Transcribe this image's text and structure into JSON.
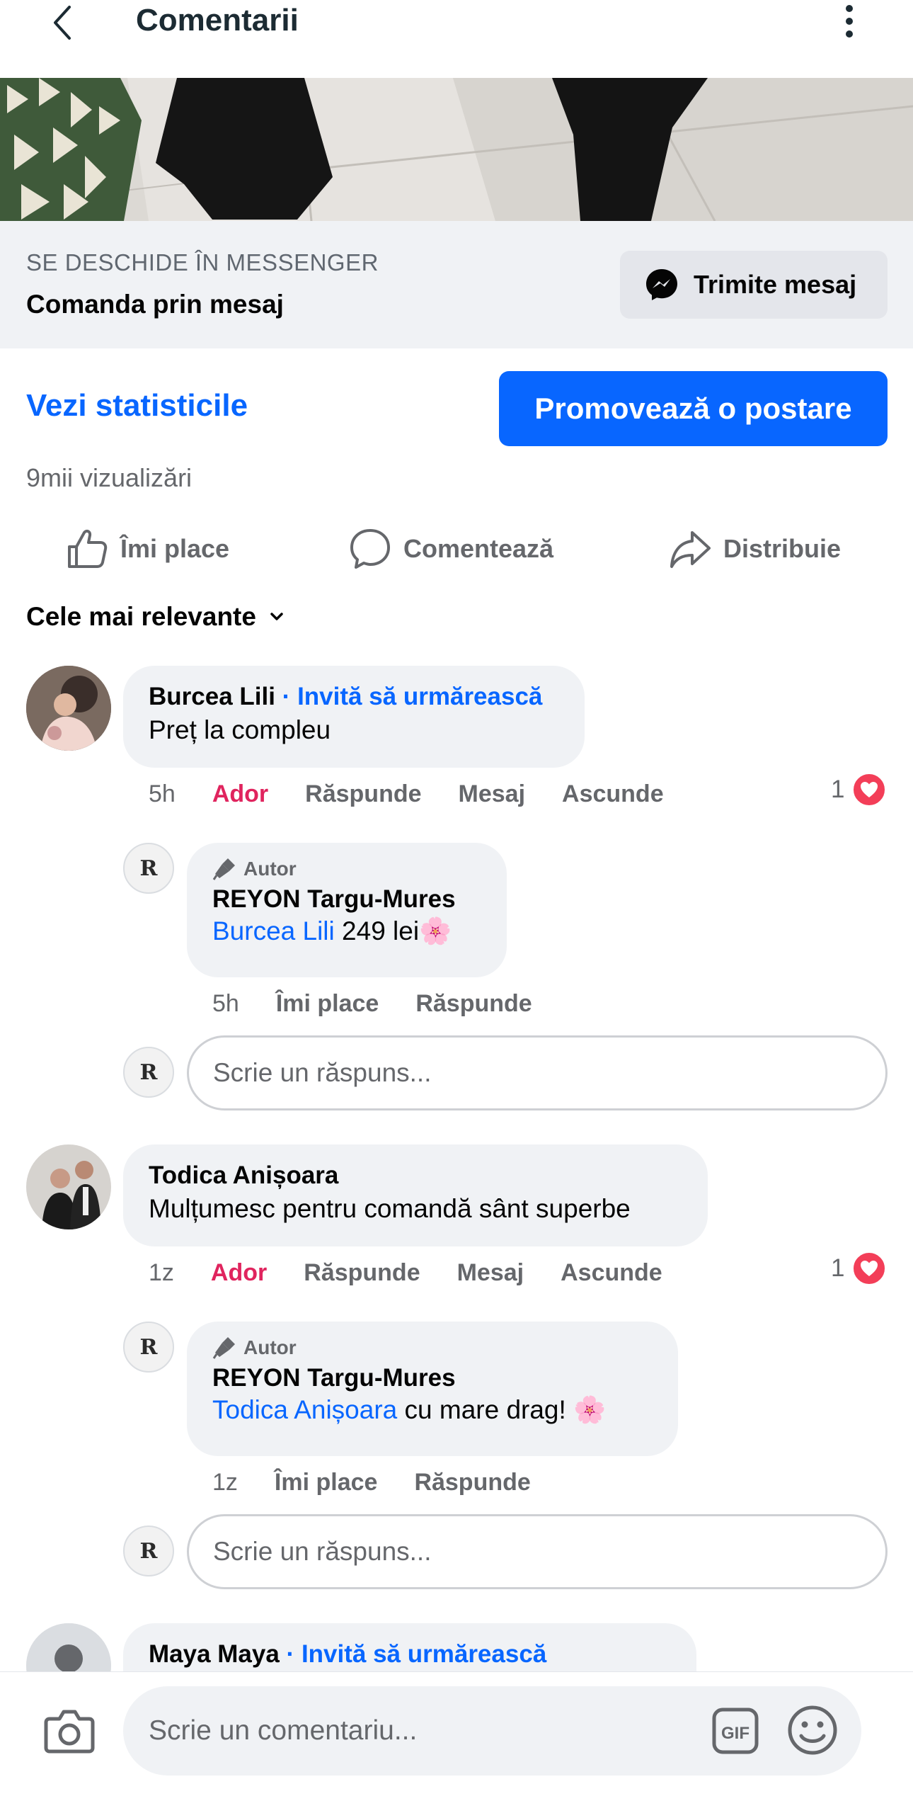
{
  "header": {
    "title": "Comentarii"
  },
  "messenger": {
    "caption": "SE DESCHIDE ÎN MESSENGER",
    "title": "Comanda prin mesaj",
    "button_label": "Trimite mesaj"
  },
  "insights": {
    "stats_link": "Vezi statisticile",
    "promote_button": "Promovează o postare",
    "views": "9mii vizualizări"
  },
  "actions": {
    "like": "Îmi place",
    "comment": "Comentează",
    "share": "Distribuie"
  },
  "sort": {
    "label": "Cele mai relevante"
  },
  "comments": [
    {
      "name": "Burcea Lili",
      "separator": " · ",
      "invite": "Invită să urmărească",
      "text": "Preț la compleu",
      "time": "5h",
      "love": "Ador",
      "reply": "Răspunde",
      "message": "Mesaj",
      "hide": "Ascunde",
      "reaction_count": "1",
      "author_reply": {
        "tag": "Autor",
        "name": "REYON Targu-Mures",
        "mention": "Burcea Lili",
        "text": " 249 lei🌸",
        "time": "5h",
        "like": "Îmi place",
        "reply": "Răspunde"
      },
      "reply_placeholder": "Scrie un răspuns..."
    },
    {
      "name": "Todica Anișoara",
      "text": "Mulțumesc pentru comandă sânt superbe",
      "time": "1z",
      "love": "Ador",
      "reply": "Răspunde",
      "message": "Mesaj",
      "hide": "Ascunde",
      "reaction_count": "1",
      "author_reply": {
        "tag": "Autor",
        "name": "REYON Targu-Mures",
        "mention": "Todica Anișoara",
        "text": " cu mare drag! 🌸",
        "time": "1z",
        "like": "Îmi place",
        "reply": "Răspunde"
      },
      "reply_placeholder": "Scrie un răspuns..."
    },
    {
      "name": "Maya Maya",
      "separator": " · ",
      "invite": "Invită să urmărească"
    }
  ],
  "page_avatar_letter": "R",
  "composer": {
    "placeholder": "Scrie un comentariu..."
  },
  "icons": {
    "back": "chevron-left-icon",
    "more": "more-vertical-icon",
    "messenger": "messenger-icon",
    "like": "thumbs-up-icon",
    "comment": "comment-bubble-icon",
    "share": "share-arrow-icon",
    "sort": "chevron-down-icon",
    "heart": "heart-icon",
    "author": "microphone-icon",
    "camera": "camera-icon",
    "gif": "gif-icon",
    "emoji": "emoji-icon"
  },
  "colors": {
    "accent": "#0866ff",
    "love": "#e0245e",
    "heart": "#f33e58",
    "bubble": "#f0f2f5"
  }
}
